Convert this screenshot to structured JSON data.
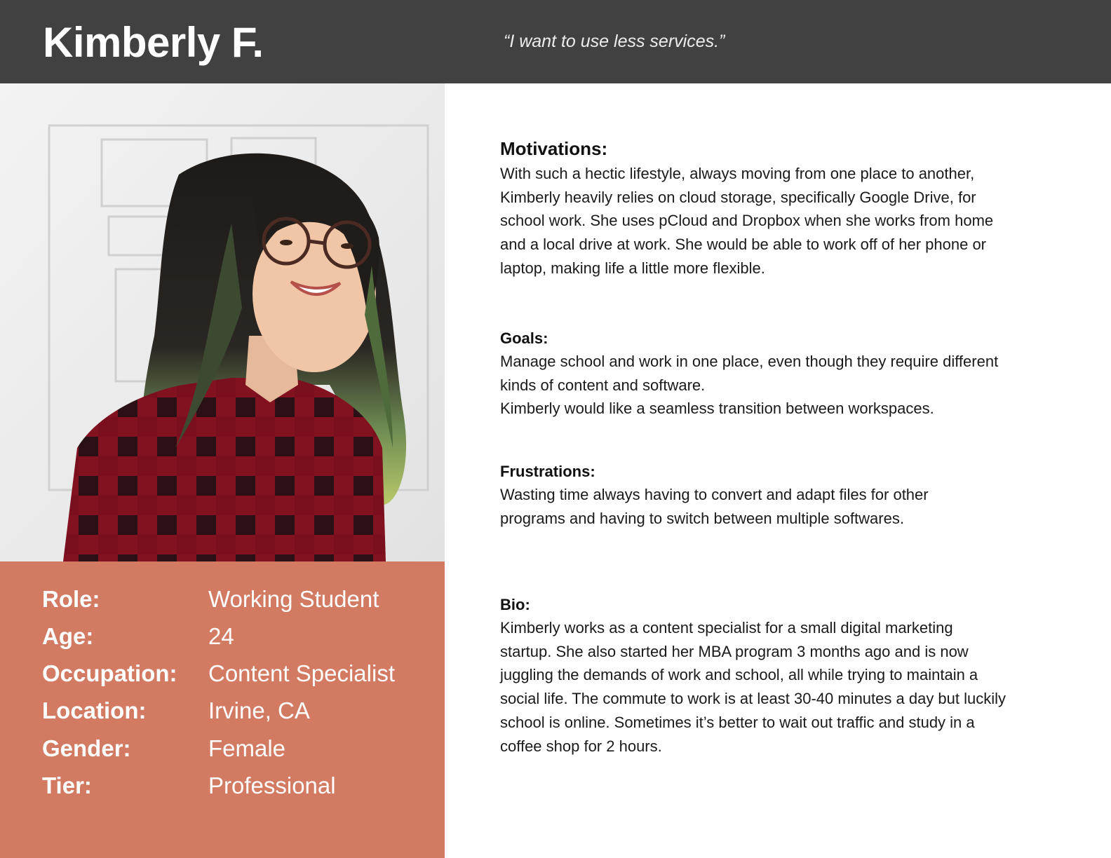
{
  "header": {
    "name": "Kimberly F.",
    "quote": "“I want to use less services.”"
  },
  "colors": {
    "header_bg": "#414141",
    "info_panel_bg": "#d37a63",
    "text_dark": "#111111"
  },
  "photo": {
    "icon": "person-photo"
  },
  "profile": {
    "rows": [
      {
        "label": "Role:",
        "value": "Working Student"
      },
      {
        "label": "Age:",
        "value": "24"
      },
      {
        "label": "Occupation:",
        "value": "Content Specialist"
      },
      {
        "label": "Location:",
        "value": "Irvine, CA"
      },
      {
        "label": "Gender:",
        "value": "Female"
      },
      {
        "label": "Tier:",
        "value": "Professional"
      }
    ]
  },
  "sections": {
    "motivations": {
      "title": "Motivations:",
      "lines": [
        "With such a hectic lifestyle, always moving from one place to another,",
        "Kimberly heavily relies on cloud storage, specifically Google Drive, for",
        "school work. She uses pCloud and Dropbox when she works from home",
        "and a local drive at work. She would be able to work off of her phone or",
        "laptop, making life a little more flexible."
      ]
    },
    "goals": {
      "title": "Goals:",
      "lines": [
        "Manage school and work in one place, even though they require different",
        "kinds of content and software.",
        "Kimberly would like a seamless transition between workspaces."
      ]
    },
    "frustrations": {
      "title": "Frustrations:",
      "lines": [
        "Wasting time always having to convert and adapt files for other",
        "programs and having to switch between multiple softwares."
      ]
    },
    "bio": {
      "title": "Bio:",
      "lines": [
        "Kimberly works as a content specialist for a small digital marketing",
        "startup. She also started her MBA program 3 months ago and is now",
        "juggling the demands of work and school, all while trying to maintain a",
        "social life. The commute to work is at least 30-40 minutes a day but luckily",
        "school is online. Sometimes it’s better to wait out traffic and study in a",
        "coffee shop for 2 hours."
      ]
    }
  }
}
